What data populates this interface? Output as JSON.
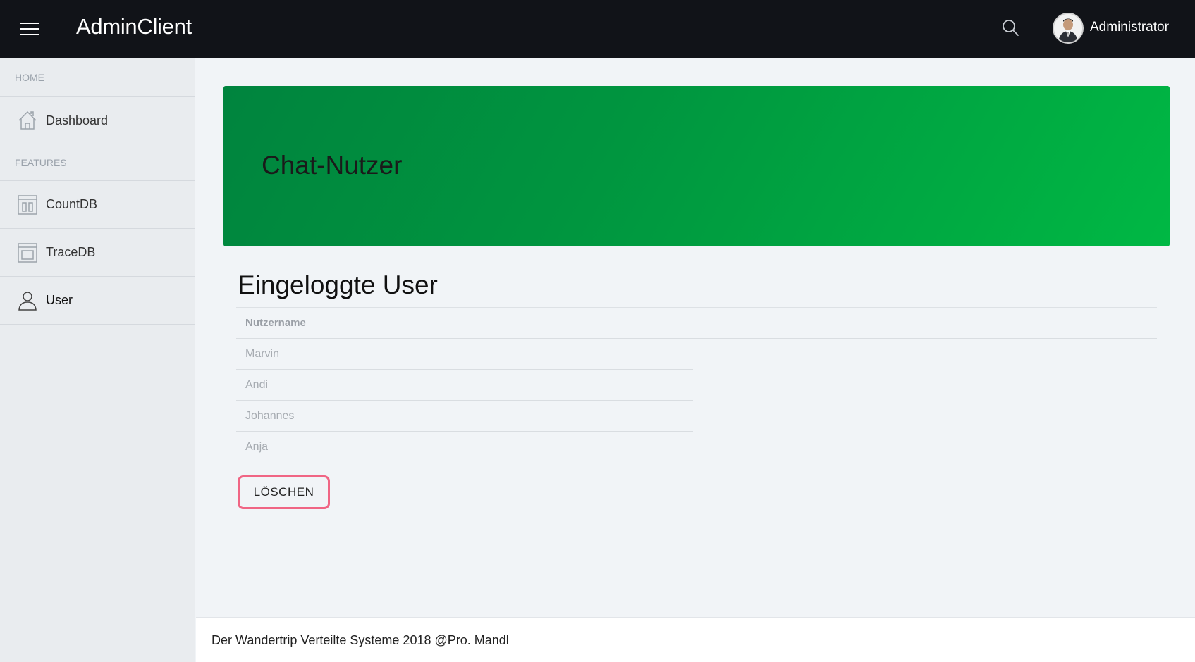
{
  "header": {
    "app_title": "AdminClient",
    "user_name": "Administrator",
    "menu_icon": "hamburger-menu-icon",
    "search_icon": "search-icon",
    "avatar_icon": "user-avatar"
  },
  "sidebar": {
    "sections": [
      {
        "label": "HOME",
        "items": [
          {
            "label": "Dashboard",
            "icon": "home-icon"
          }
        ]
      },
      {
        "label": "FEATURES",
        "items": [
          {
            "label": "CountDB",
            "icon": "columns-icon"
          },
          {
            "label": "TraceDB",
            "icon": "window-icon"
          },
          {
            "label": "User",
            "icon": "user-icon",
            "active": true
          }
        ]
      }
    ]
  },
  "banner": {
    "title": "Chat-Nutzer"
  },
  "users_section": {
    "title": "Eingeloggte User",
    "column_header": "Nutzername",
    "rows": [
      "Marvin",
      "Andi",
      "Johannes",
      "Anja"
    ],
    "delete_label": "LÖSCHEN"
  },
  "footer": {
    "text": "Der Wandertrip Verteilte Systeme 2018 @Pro. Mandl"
  },
  "colors": {
    "topbar": "#111318",
    "sidebar": "#e9ecef",
    "banner_start": "#00843e",
    "banner_end": "#00b844",
    "delete_border": "#f06584"
  }
}
